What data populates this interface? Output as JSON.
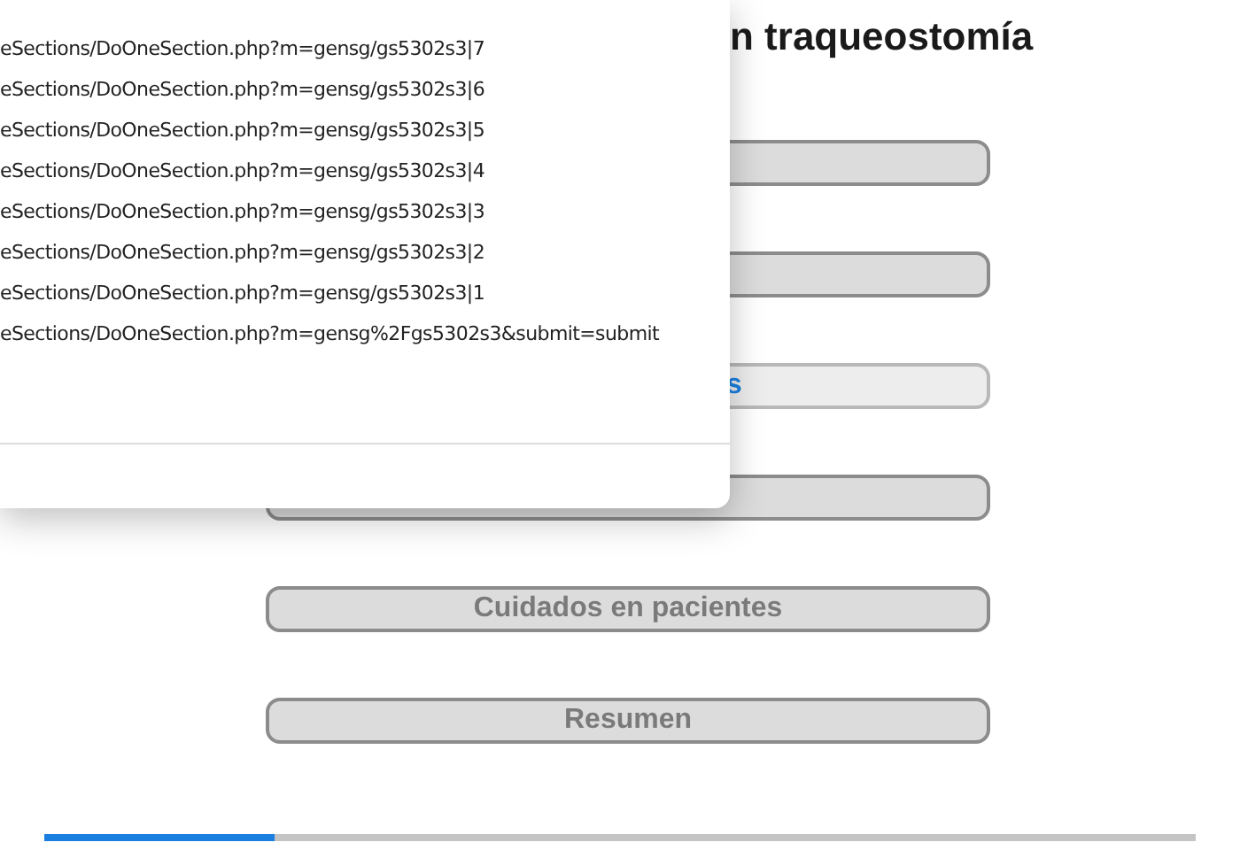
{
  "page": {
    "title": "n traqueostomía"
  },
  "sections": [
    {
      "selected": false
    },
    {
      "selected": false
    },
    {
      "label": "s",
      "selected": true
    },
    {
      "selected": false
    },
    {
      "label": "Cuidados en pacientes",
      "selected": false
    },
    {
      "label": "Resumen",
      "selected": false
    }
  ],
  "progress": {
    "level": 0.2
  },
  "history_dropdown": {
    "items": [
      "eSections/DoOneSection.php?m=gensg/gs5302s3|7",
      "eSections/DoOneSection.php?m=gensg/gs5302s3|6",
      "eSections/DoOneSection.php?m=gensg/gs5302s3|5",
      "eSections/DoOneSection.php?m=gensg/gs5302s3|4",
      "eSections/DoOneSection.php?m=gensg/gs5302s3|3",
      "eSections/DoOneSection.php?m=gensg/gs5302s3|2",
      "eSections/DoOneSection.php?m=gensg/gs5302s3|1",
      "eSections/DoOneSection.php?m=gensg%2Fgs5302s3&submit=submit"
    ]
  }
}
